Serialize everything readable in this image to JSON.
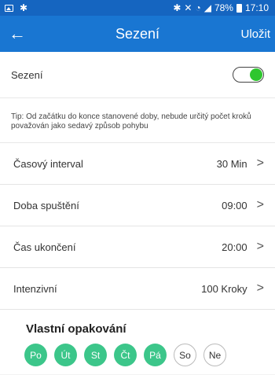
{
  "status_bar": {
    "battery": "78%",
    "time": "17:10"
  },
  "header": {
    "title": "Sezení",
    "save_label": "Uložit"
  },
  "toggle": {
    "label": "Sezení",
    "enabled": true,
    "color_on": "#2ec62e"
  },
  "tip": "Tip: Od začátku do konce stanovené doby, nebude určitý počet kroků považován jako sedavý způsob pohybu",
  "settings": [
    {
      "label": "Časový interval",
      "value": "30 Min"
    },
    {
      "label": "Doba spuštění",
      "value": "09:00"
    },
    {
      "label": "Čas ukončení",
      "value": "20:00"
    },
    {
      "label": "Intenzivní",
      "value": "100 Kroky"
    }
  ],
  "repeat": {
    "title": "Vlastní opakování",
    "days": [
      {
        "label": "Po",
        "selected": true
      },
      {
        "label": "Út",
        "selected": true
      },
      {
        "label": "St",
        "selected": true
      },
      {
        "label": "Čt",
        "selected": true
      },
      {
        "label": "Pá",
        "selected": true
      },
      {
        "label": "So",
        "selected": false
      },
      {
        "label": "Ne",
        "selected": false
      }
    ],
    "color_selected": "#3cc68a"
  }
}
